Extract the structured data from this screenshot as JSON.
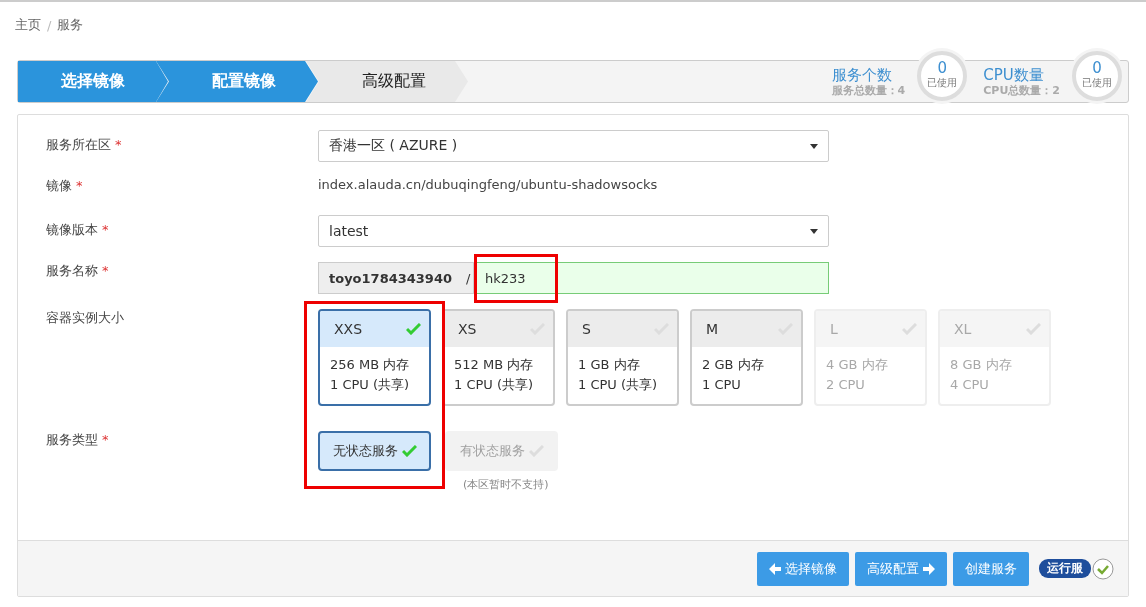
{
  "breadcrumb": {
    "items": [
      {
        "label": "主页"
      },
      {
        "label": "服务"
      }
    ],
    "separator": "/"
  },
  "steps": [
    {
      "label": "选择镜像",
      "completed": true
    },
    {
      "label": "配置镜像",
      "completed": true
    },
    {
      "label": "高级配置",
      "completed": false
    }
  ],
  "quotas": [
    {
      "title": "服务个数",
      "total": "服务总数量：4",
      "used": "0",
      "used_label": "已使用"
    },
    {
      "title": "CPU数量",
      "total": "CPU总数量：2",
      "used": "0",
      "used_label": "已使用"
    }
  ],
  "form": {
    "fields": [
      {
        "kind": "select",
        "label": "服务所在区",
        "required_mark": "*",
        "value": "香港一区 ( AZURE )"
      },
      {
        "kind": "text",
        "label": "镜像",
        "required_mark": "*",
        "value": "index.alauda.cn/dubuqingfeng/ubuntu-shadowsocks"
      },
      {
        "kind": "select",
        "label": "镜像版本",
        "required_mark": "*",
        "value": "latest"
      },
      {
        "kind": "name",
        "label": "服务名称",
        "required_mark": "*",
        "prefix": "toyo1784343940",
        "separator": "/",
        "value": "hk233"
      },
      {
        "kind": "sizes",
        "label": "容器实例大小",
        "options": [
          {
            "name": "XXS",
            "memory": "256 MB 内存",
            "cpu": "1 CPU (共享)",
            "selected": true,
            "disabled": false
          },
          {
            "name": "XS",
            "memory": "512 MB 内存",
            "cpu": "1 CPU (共享)",
            "selected": false,
            "disabled": false
          },
          {
            "name": "S",
            "memory": "1 GB 内存",
            "cpu": "1 CPU (共享)",
            "selected": false,
            "disabled": false
          },
          {
            "name": "M",
            "memory": "2 GB 内存",
            "cpu": "1 CPU",
            "selected": false,
            "disabled": false
          },
          {
            "name": "L",
            "memory": "4 GB 内存",
            "cpu": "2 CPU",
            "selected": false,
            "disabled": true
          },
          {
            "name": "XL",
            "memory": "8 GB 内存",
            "cpu": "4 CPU",
            "selected": false,
            "disabled": true
          }
        ]
      },
      {
        "kind": "types",
        "label": "服务类型",
        "required_mark": "*",
        "options": [
          {
            "label": "无状态服务",
            "selected": true,
            "disabled": false
          },
          {
            "label": "有状态服务",
            "selected": false,
            "disabled": true
          }
        ],
        "note": "(本区暂时不支持)"
      }
    ]
  },
  "footer": {
    "buttons": [
      {
        "label": "选择镜像",
        "kind": "back"
      },
      {
        "label": "高级配置",
        "kind": "forward"
      },
      {
        "label": "创建服务",
        "kind": "plain"
      }
    ],
    "run_badge": {
      "label": "运行服"
    }
  }
}
